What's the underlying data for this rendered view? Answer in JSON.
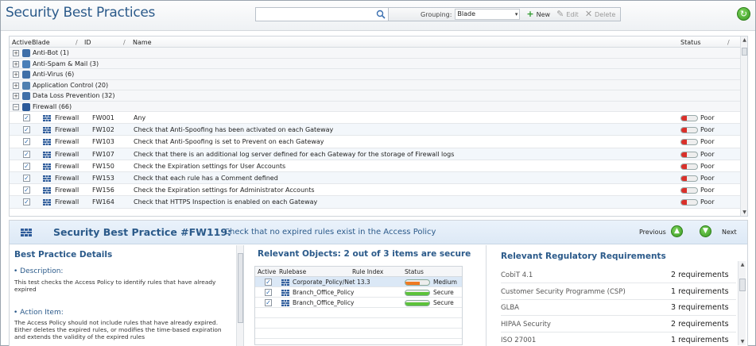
{
  "app": {
    "title": "Security Best Practices"
  },
  "toolbar": {
    "search_value": "",
    "grouping_label": "Grouping:",
    "grouping_value": "Blade",
    "new_label": "New",
    "edit_label": "Edit",
    "delete_label": "Delete"
  },
  "grid": {
    "columns": {
      "active": "Active",
      "blade": "Blade",
      "id": "ID",
      "name": "Name",
      "status": "Status"
    },
    "groups": [
      {
        "label": "Anti-Bot (1)",
        "icon": "anti-bot-icon",
        "color": "#3f6fa8"
      },
      {
        "label": "Anti-Spam & Mail (3)",
        "icon": "anti-spam-icon",
        "color": "#4a7fb8"
      },
      {
        "label": "Anti-Virus (6)",
        "icon": "anti-virus-icon",
        "color": "#3f6fa8"
      },
      {
        "label": "Application Control (20)",
        "icon": "app-control-icon",
        "color": "#4f7fb0"
      },
      {
        "label": "Data Loss Prevention (32)",
        "icon": "dlp-icon",
        "color": "#3f6fa8"
      },
      {
        "label": "Firewall (66)",
        "icon": "firewall-icon",
        "color": "#2c5a9a"
      }
    ],
    "rows": [
      {
        "blade": "Firewall",
        "id": "FW001",
        "name": "Any",
        "status": "Poor"
      },
      {
        "blade": "Firewall",
        "id": "FW102",
        "name": "Check that Anti-Spoofing has been activated on each Gateway",
        "status": "Poor"
      },
      {
        "blade": "Firewall",
        "id": "FW103",
        "name": "Check that Anti-Spoofing is set to Prevent on each Gateway",
        "status": "Poor"
      },
      {
        "blade": "Firewall",
        "id": "FW107",
        "name": "Check that there is an additional log server defined for each Gateway for the storage of Firewall logs",
        "status": "Poor"
      },
      {
        "blade": "Firewall",
        "id": "FW150",
        "name": "Check the Expiration settings for User Accounts",
        "status": "Poor"
      },
      {
        "blade": "Firewall",
        "id": "FW153",
        "name": "Check that each rule has a Comment defined",
        "status": "Poor"
      },
      {
        "blade": "Firewall",
        "id": "FW156",
        "name": "Check the Expiration settings for Administrator Accounts",
        "status": "Poor"
      },
      {
        "blade": "Firewall",
        "id": "FW164",
        "name": "Check that HTTPS Inspection is enabled on each Gateway",
        "status": "Poor"
      }
    ],
    "poor_color": "#d9302a"
  },
  "detail": {
    "title": "Security Best Practice #FW119:",
    "description": "Check that no expired rules exist in the Access Policy",
    "prev_label": "Previous",
    "next_label": "Next",
    "left": {
      "heading": "Best Practice Details",
      "desc_title": "Description:",
      "desc_text": "This test checks the Access Policy to identify rules that have already expired",
      "action_title": "Action Item:",
      "action_text": "The Access Policy should not include rules that have already expired. Either deletes the expired rules, or modifies the time-based expiration and extends the validity of the expired rules"
    },
    "objects": {
      "heading": "Relevant Objects: 2 out of 3 items are secure",
      "columns": {
        "active": "Active",
        "rulebase": "Rulebase",
        "rule_index": "Rule Index",
        "status": "Status"
      },
      "rows": [
        {
          "rulebase": "Corporate_Policy/Net",
          "rule_index": "13.3",
          "status": "Medium",
          "color": "#f07a22"
        },
        {
          "rulebase": "Branch_Office_Policy",
          "rule_index": "",
          "status": "Secure",
          "color": "#5cc23a"
        },
        {
          "rulebase": "Branch_Office_Policy",
          "rule_index": "",
          "status": "Secure",
          "color": "#5cc23a"
        }
      ]
    },
    "requirements": {
      "heading": "Relevant Regulatory Requirements",
      "rows": [
        {
          "name": "CobiT 4.1",
          "count": "2 requirements"
        },
        {
          "name": "Customer Security Programme (CSP)",
          "count": "1 requirements"
        },
        {
          "name": "GLBA",
          "count": "3 requirements"
        },
        {
          "name": "HIPAA Security",
          "count": "2 requirements"
        },
        {
          "name": "ISO 27001",
          "count": "1 requirements"
        }
      ]
    }
  }
}
